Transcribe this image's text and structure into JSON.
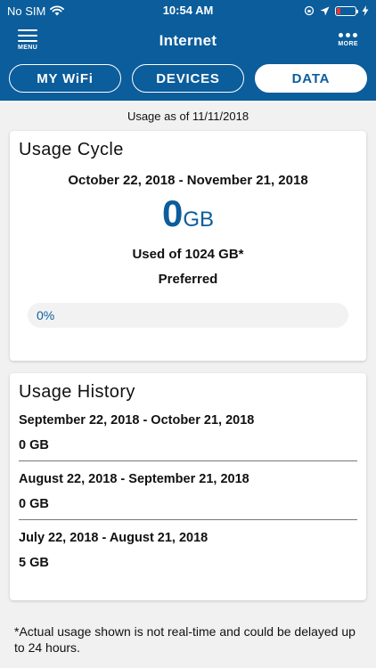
{
  "status": {
    "carrier": "No SIM",
    "time": "10:54 AM"
  },
  "nav": {
    "title": "Internet",
    "menu_label": "MENU",
    "more_label": "MORE"
  },
  "tabs": [
    {
      "label": "MY WiFi"
    },
    {
      "label": "DEVICES"
    },
    {
      "label": "DATA"
    }
  ],
  "usage_as_of": "Usage as of 11/11/2018",
  "cycle": {
    "title": "Usage Cycle",
    "range": "October 22, 2018 - November 21, 2018",
    "amount": "0",
    "unit": "GB",
    "used_of": "Used of 1024 GB*",
    "plan": "Preferred",
    "progress_label": "0%",
    "progress_fraction": 0.0
  },
  "history": {
    "title": "Usage History",
    "items": [
      {
        "range": "September 22, 2018 - October 21, 2018",
        "value": "0 GB"
      },
      {
        "range": "August 22, 2018 - September 21, 2018",
        "value": "0 GB"
      },
      {
        "range": "July 22, 2018 - August 21, 2018",
        "value": "5 GB"
      }
    ]
  },
  "footnote": "*Actual usage shown is not real-time and could be delayed up to 24 hours.",
  "colors": {
    "brand": "#0b5d9c",
    "battery_low": "#e33333"
  }
}
